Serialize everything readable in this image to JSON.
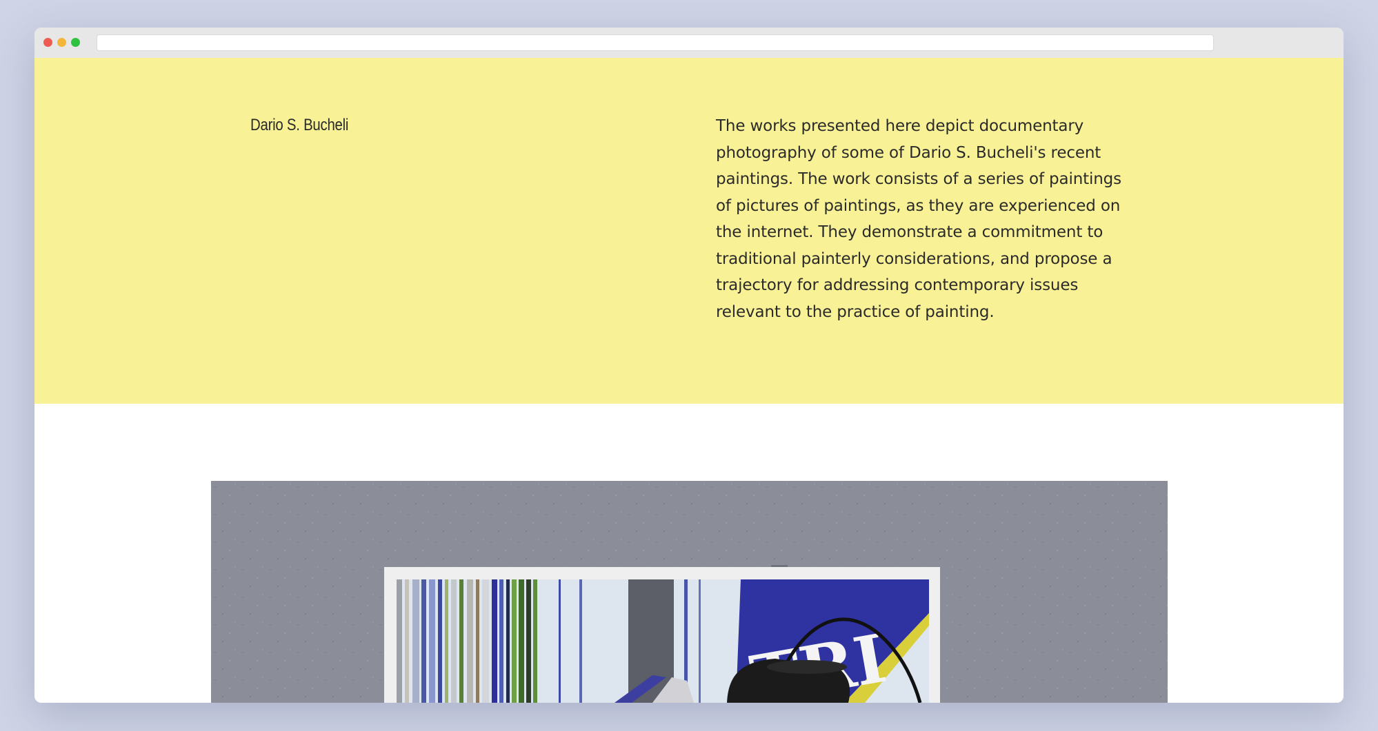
{
  "browser": {
    "url": ""
  },
  "hero": {
    "artist_name": "Dario S. Bucheli",
    "description": "The works presented here depict documentary photography of some of Dario S. Bucheli's recent paintings. The work consists of a series of paintings of pictures of paintings, as they are experienced on the internet. They demonstrate a commitment to traditional painterly considerations, and propose a trajectory for addressing contemporary issues relevant to the practice of painting."
  },
  "artwork": {
    "painting_lettering": "TRI"
  },
  "colors": {
    "page_background": "#cfd4e6",
    "hero_background": "#f8f195",
    "text": "#2b2b2b",
    "wall": "#8a8d98",
    "stripe_blue": "#3535a0",
    "stripe_green": "#5e8f3a",
    "lamp": "#1b1b1b"
  }
}
